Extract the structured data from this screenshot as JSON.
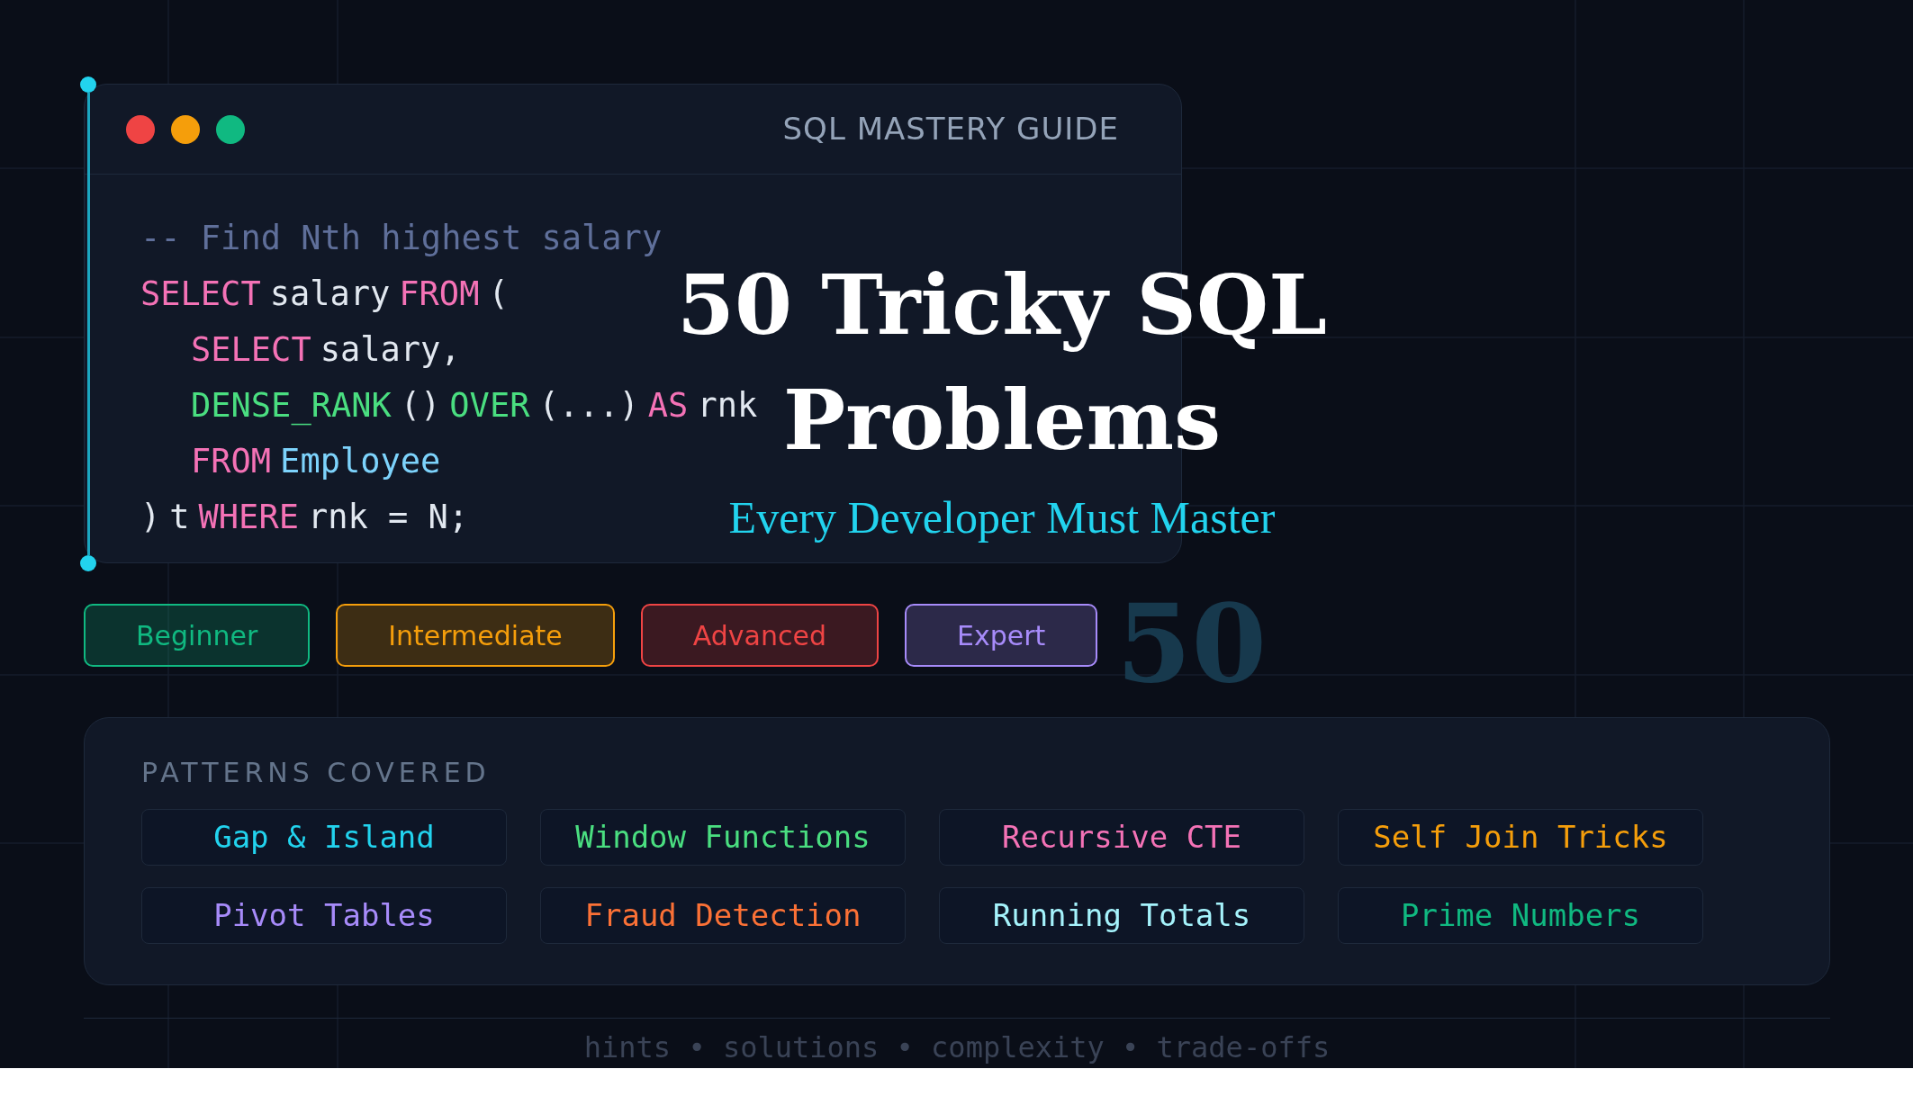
{
  "window": {
    "title": "SQL MASTERY GUIDE"
  },
  "code_lines": [
    {
      "indent": false,
      "tokens": [
        {
          "kind": "comment",
          "text": "-- Find Nth highest salary"
        }
      ]
    },
    {
      "indent": false,
      "tokens": [
        {
          "kind": "keyword",
          "text": "SELECT"
        },
        {
          "kind": "plain",
          "text": "salary"
        },
        {
          "kind": "keyword",
          "text": "FROM"
        },
        {
          "kind": "plain",
          "text": "("
        }
      ]
    },
    {
      "indent": true,
      "tokens": [
        {
          "kind": "keyword",
          "text": "SELECT"
        },
        {
          "kind": "plain",
          "text": "salary,"
        }
      ]
    },
    {
      "indent": true,
      "tokens": [
        {
          "kind": "function",
          "text": "DENSE_RANK"
        },
        {
          "kind": "plain",
          "text": "()"
        },
        {
          "kind": "function",
          "text": "OVER"
        },
        {
          "kind": "plain",
          "text": "(...)"
        },
        {
          "kind": "keyword",
          "text": "AS"
        },
        {
          "kind": "plain",
          "text": "rnk"
        }
      ]
    },
    {
      "indent": true,
      "tokens": [
        {
          "kind": "keyword",
          "text": "FROM"
        },
        {
          "kind": "table",
          "text": "Employee"
        }
      ]
    },
    {
      "indent": false,
      "tokens": [
        {
          "kind": "plain",
          "text": ")"
        },
        {
          "kind": "plain",
          "text": "t"
        },
        {
          "kind": "keyword",
          "text": "WHERE"
        },
        {
          "kind": "plain",
          "text": "rnk = N;"
        }
      ]
    }
  ],
  "headline": {
    "title_lines": [
      "50 Tricky SQL",
      "Problems"
    ],
    "subtitle": "Every Developer Must Master"
  },
  "background_number": "50",
  "levels": [
    {
      "label": "Beginner",
      "color": "#10b981"
    },
    {
      "label": "Intermediate",
      "color": "#f59e0b"
    },
    {
      "label": "Advanced",
      "color": "#ef4444"
    },
    {
      "label": "Expert",
      "color": "#a78bfa"
    }
  ],
  "patterns": {
    "heading": "PATTERNS COVERED",
    "items": [
      {
        "label": "Gap & Island",
        "color": "#22d3ee"
      },
      {
        "label": "Window Functions",
        "color": "#4ade80"
      },
      {
        "label": "Recursive CTE",
        "color": "#f472b6"
      },
      {
        "label": "Self Join Tricks",
        "color": "#f59e0b"
      },
      {
        "label": "Pivot Tables",
        "color": "#a78bfa"
      },
      {
        "label": "Fraud Detection",
        "color": "#fb7136"
      },
      {
        "label": "Running Totals",
        "color": "#a5f3fc"
      },
      {
        "label": "Prime Numbers",
        "color": "#10b981"
      }
    ]
  },
  "footer": "hints • solutions • complexity • trade-offs"
}
